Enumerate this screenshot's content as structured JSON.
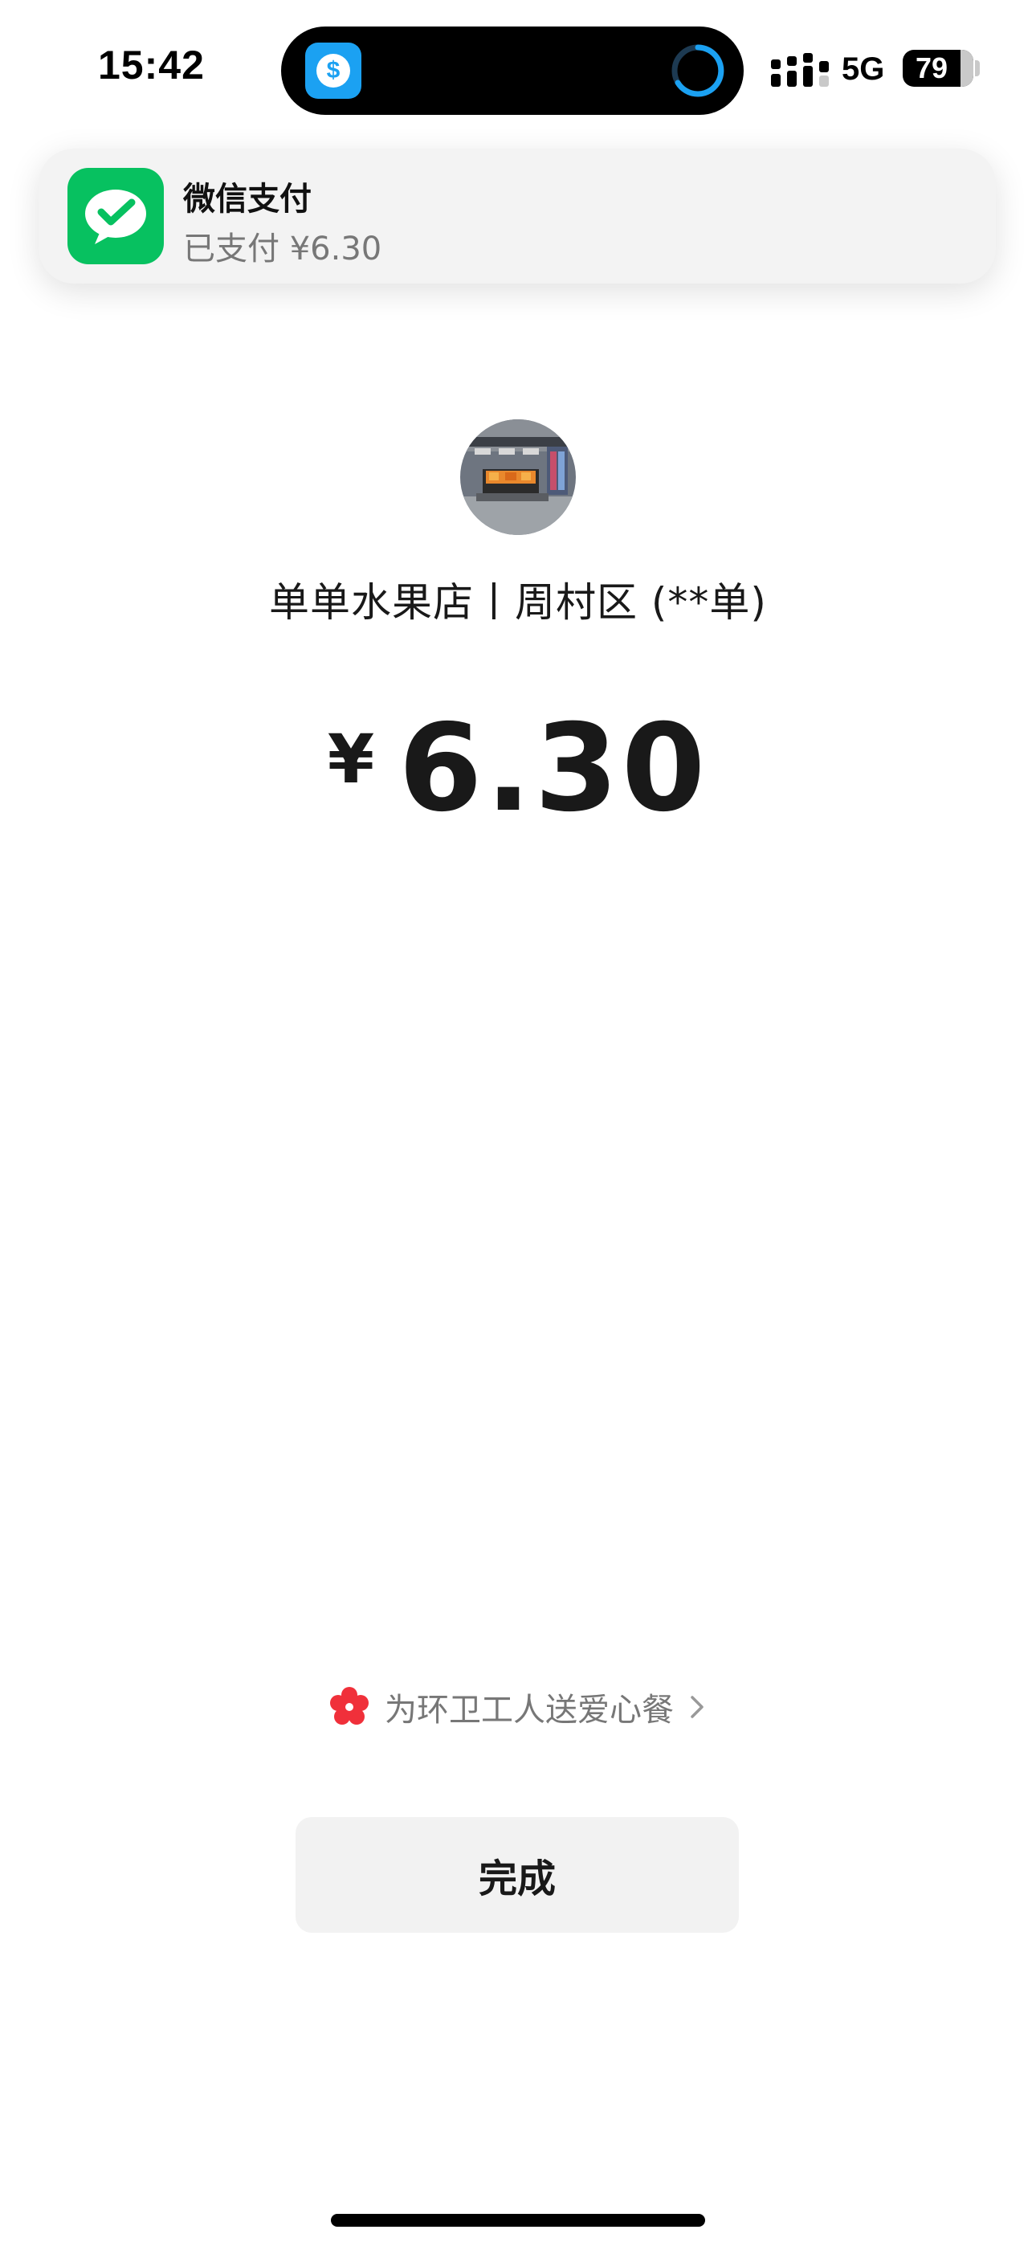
{
  "status_bar": {
    "time": "15:42",
    "network": "5G",
    "battery_level": "79",
    "signal_bars": 4,
    "island_app_icon": "dollar-coin-icon",
    "island_activity_icon": "progress-ring-icon"
  },
  "notification": {
    "app_icon": "wechat-pay-icon",
    "title": "微信支付",
    "body": "已支付 ¥6.30"
  },
  "merchant": {
    "avatar_icon": "store-photo-avatar",
    "name": "单单水果店丨周村区 (**单)"
  },
  "payment": {
    "currency_symbol": "¥",
    "amount": "6.30"
  },
  "charity": {
    "icon": "red-flower-icon",
    "label": "为环卫工人送爱心餐",
    "chevron_icon": "chevron-right-icon"
  },
  "actions": {
    "done_label": "完成"
  },
  "colors": {
    "wechat_green": "#07c160",
    "island_blue": "#1ba1f2",
    "charity_red": "#f0303a",
    "text_primary": "#191919",
    "text_secondary": "#777777",
    "button_bg": "#f2f2f2"
  }
}
